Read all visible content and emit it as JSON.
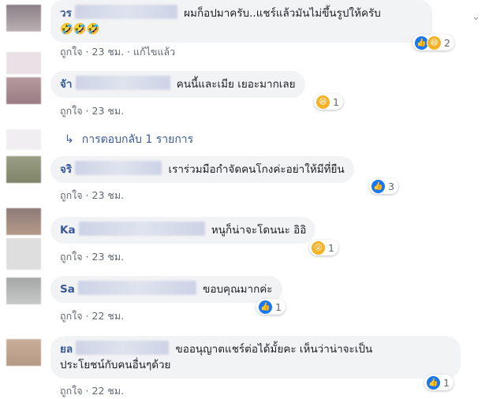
{
  "comments": [
    {
      "name": "วร",
      "text": "ผมก็อปมาครับ..แชร์แล้วมันไม่ขึ้นรูปให้ครับ",
      "emojis": "🤣🤣🤣",
      "like": "ถูกใจ",
      "time": "23 ชม.",
      "edited": "แก้ไขแล้ว",
      "reaction_count": "2"
    },
    {
      "name": "จัา",
      "text": "คนนี้และเมีย เยอะมากเลย",
      "like": "ถูกใจ",
      "time": "23 ชม.",
      "reaction_count": "1"
    },
    {
      "name": "จริ",
      "text": "เราร่วมมือกำจัดคนโกงค่ะอย่าให้มีที่ยืน",
      "like": "ถูกใจ",
      "time": "23 ชม.",
      "reaction_count": "3"
    },
    {
      "name": "Ka",
      "text": "หนูก็น่าจะโดนนะ อิอิ",
      "like": "ถูกใจ",
      "time": "23 ชม.",
      "reaction_count": "1"
    },
    {
      "name": "Sa",
      "text": "ขอบคุณมากค่ะ",
      "like": "ถูกใจ",
      "time": "22 ชม.",
      "reaction_count": "1"
    },
    {
      "name": "ยล",
      "text": "ขออนุญาตแชร์ต่อได้มั้ยคะ เห็นว่าน่าจะเป็น",
      "text2": "ประโยชน์กับคนอื่นๆด้วย",
      "like": "ถูกใจ",
      "time": "22 ชม.",
      "reaction_count": "1"
    }
  ],
  "reply": {
    "label": "การตอบกลับ 1 รายการ"
  },
  "separator": " · ",
  "colors": {
    "link": "#385898",
    "bubble": "#f2f3f5",
    "meta": "#606770"
  }
}
